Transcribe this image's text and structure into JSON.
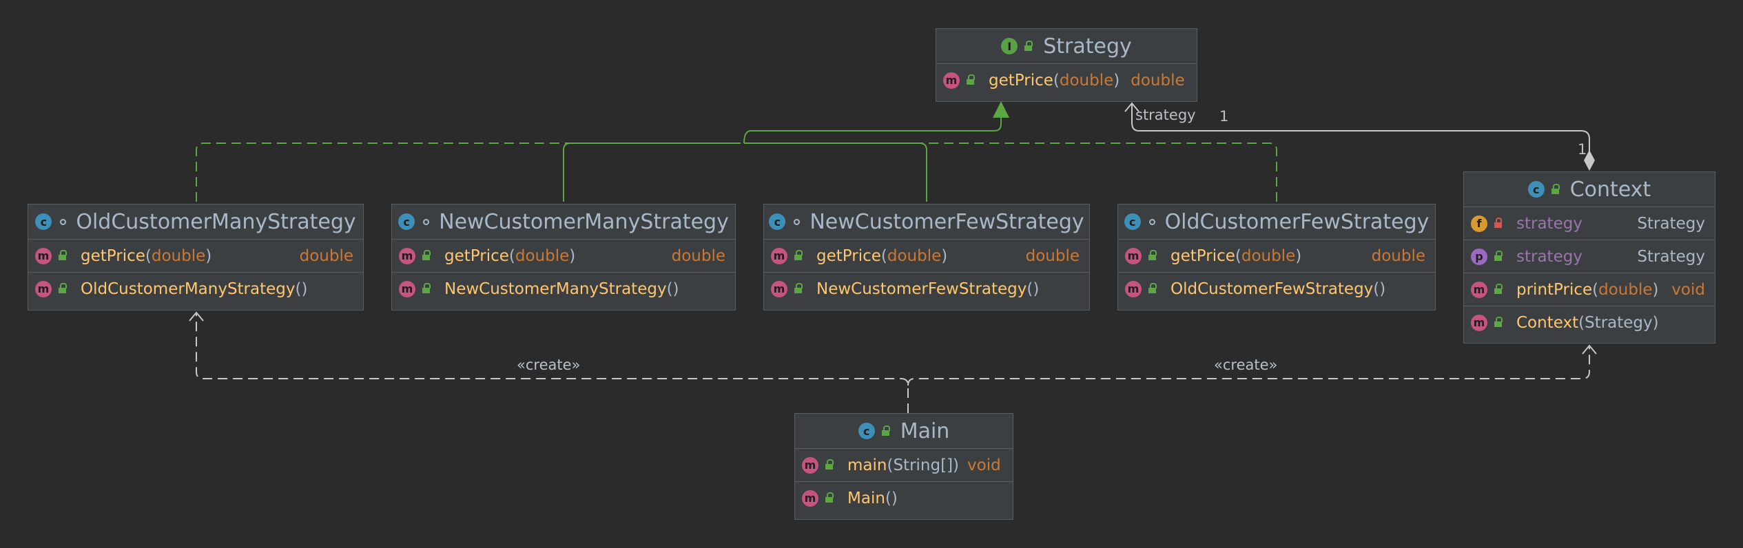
{
  "nodes": {
    "strategy": {
      "name": "Strategy",
      "kind": "I",
      "visibility": "public",
      "members": [
        {
          "kind": "m",
          "visibility": "public",
          "name": "getPrice",
          "params": "double",
          "returns": "double"
        }
      ]
    },
    "old_many": {
      "name": "OldCustomerManyStrategy",
      "kind": "C",
      "visibility": "package",
      "members": [
        {
          "kind": "m",
          "visibility": "public",
          "name": "getPrice",
          "params": "double",
          "returns": "double"
        },
        {
          "kind": "m",
          "visibility": "public",
          "name": "OldCustomerManyStrategy",
          "params": "",
          "returns": ""
        }
      ]
    },
    "new_many": {
      "name": "NewCustomerManyStrategy",
      "kind": "C",
      "visibility": "package",
      "members": [
        {
          "kind": "m",
          "visibility": "public",
          "name": "getPrice",
          "params": "double",
          "returns": "double"
        },
        {
          "kind": "m",
          "visibility": "public",
          "name": "NewCustomerManyStrategy",
          "params": "",
          "returns": ""
        }
      ]
    },
    "new_few": {
      "name": "NewCustomerFewStrategy",
      "kind": "C",
      "visibility": "package",
      "members": [
        {
          "kind": "m",
          "visibility": "public",
          "name": "getPrice",
          "params": "double",
          "returns": "double"
        },
        {
          "kind": "m",
          "visibility": "public",
          "name": "NewCustomerFewStrategy",
          "params": "",
          "returns": ""
        }
      ]
    },
    "old_few": {
      "name": "OldCustomerFewStrategy",
      "kind": "C",
      "visibility": "package",
      "members": [
        {
          "kind": "m",
          "visibility": "public",
          "name": "getPrice",
          "params": "double",
          "returns": "double"
        },
        {
          "kind": "m",
          "visibility": "public",
          "name": "OldCustomerFewStrategy",
          "params": "",
          "returns": ""
        }
      ]
    },
    "context": {
      "name": "Context",
      "kind": "C",
      "visibility": "public",
      "members": [
        {
          "kind": "f",
          "visibility": "private",
          "name": "strategy",
          "type": "Strategy"
        },
        {
          "kind": "p",
          "visibility": "public",
          "name": "strategy",
          "type": "Strategy"
        },
        {
          "kind": "m",
          "visibility": "public",
          "name": "printPrice",
          "params": "double",
          "returns": "void"
        },
        {
          "kind": "m",
          "visibility": "public",
          "name": "Context",
          "params": "Strategy",
          "returns": ""
        }
      ]
    },
    "main": {
      "name": "Main",
      "kind": "C",
      "visibility": "public",
      "members": [
        {
          "kind": "m",
          "visibility": "public",
          "name": "main",
          "params": "String[]",
          "returns": "void"
        },
        {
          "kind": "m",
          "visibility": "public",
          "name": "Main",
          "params": "",
          "returns": ""
        }
      ]
    }
  },
  "edge_labels": {
    "strategy_role": "strategy",
    "strategy_mult_target": "1",
    "strategy_mult_source": "1",
    "create_left": "«create»",
    "create_right": "«create»"
  },
  "colors": {
    "background": "#2b2b2b",
    "realization": "#5ca644",
    "dependency": "#c8c8c8",
    "association": "#c8c8c8"
  }
}
